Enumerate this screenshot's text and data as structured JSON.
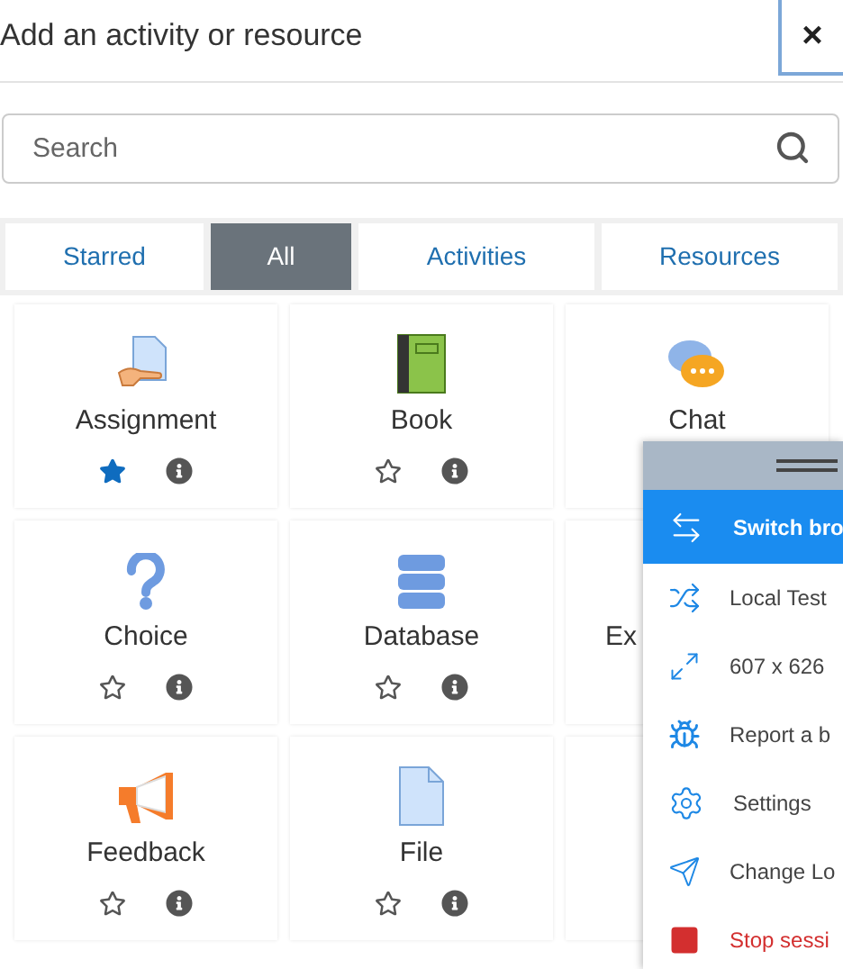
{
  "dialog": {
    "title": "Add an activity or resource",
    "close": "×"
  },
  "search": {
    "placeholder": "Search"
  },
  "tabs": [
    {
      "label": "Starred",
      "selected": false
    },
    {
      "label": "All",
      "selected": true
    },
    {
      "label": "Activities",
      "selected": false
    },
    {
      "label": "Resources",
      "selected": false
    }
  ],
  "modules": [
    {
      "kind": "full",
      "name": "Assignment",
      "starred": true
    },
    {
      "kind": "full",
      "name": "Book",
      "starred": false
    },
    {
      "kind": "top",
      "name": "Chat"
    },
    {
      "kind": "full",
      "name": "Choice",
      "starred": false
    },
    {
      "kind": "full",
      "name": "Database",
      "starred": false
    },
    {
      "kind": "clipped",
      "name": "Ex"
    },
    {
      "kind": "full",
      "name": "Feedback",
      "starred": false
    },
    {
      "kind": "full",
      "name": "File",
      "starred": false
    },
    {
      "kind": "blank"
    }
  ],
  "overlay_menu": {
    "items": [
      {
        "label": "Switch bro",
        "selected": true,
        "kind": "normal"
      },
      {
        "label": "Local Test",
        "selected": false,
        "kind": "normal"
      },
      {
        "label": "607 x 626",
        "selected": false,
        "kind": "normal"
      },
      {
        "label": "Report a b",
        "selected": false,
        "kind": "normal"
      },
      {
        "label": "Settings",
        "selected": false,
        "kind": "normal"
      },
      {
        "label": "Change Lo",
        "selected": false,
        "kind": "normal"
      },
      {
        "label": "Stop sessi",
        "selected": false,
        "kind": "danger"
      }
    ]
  }
}
